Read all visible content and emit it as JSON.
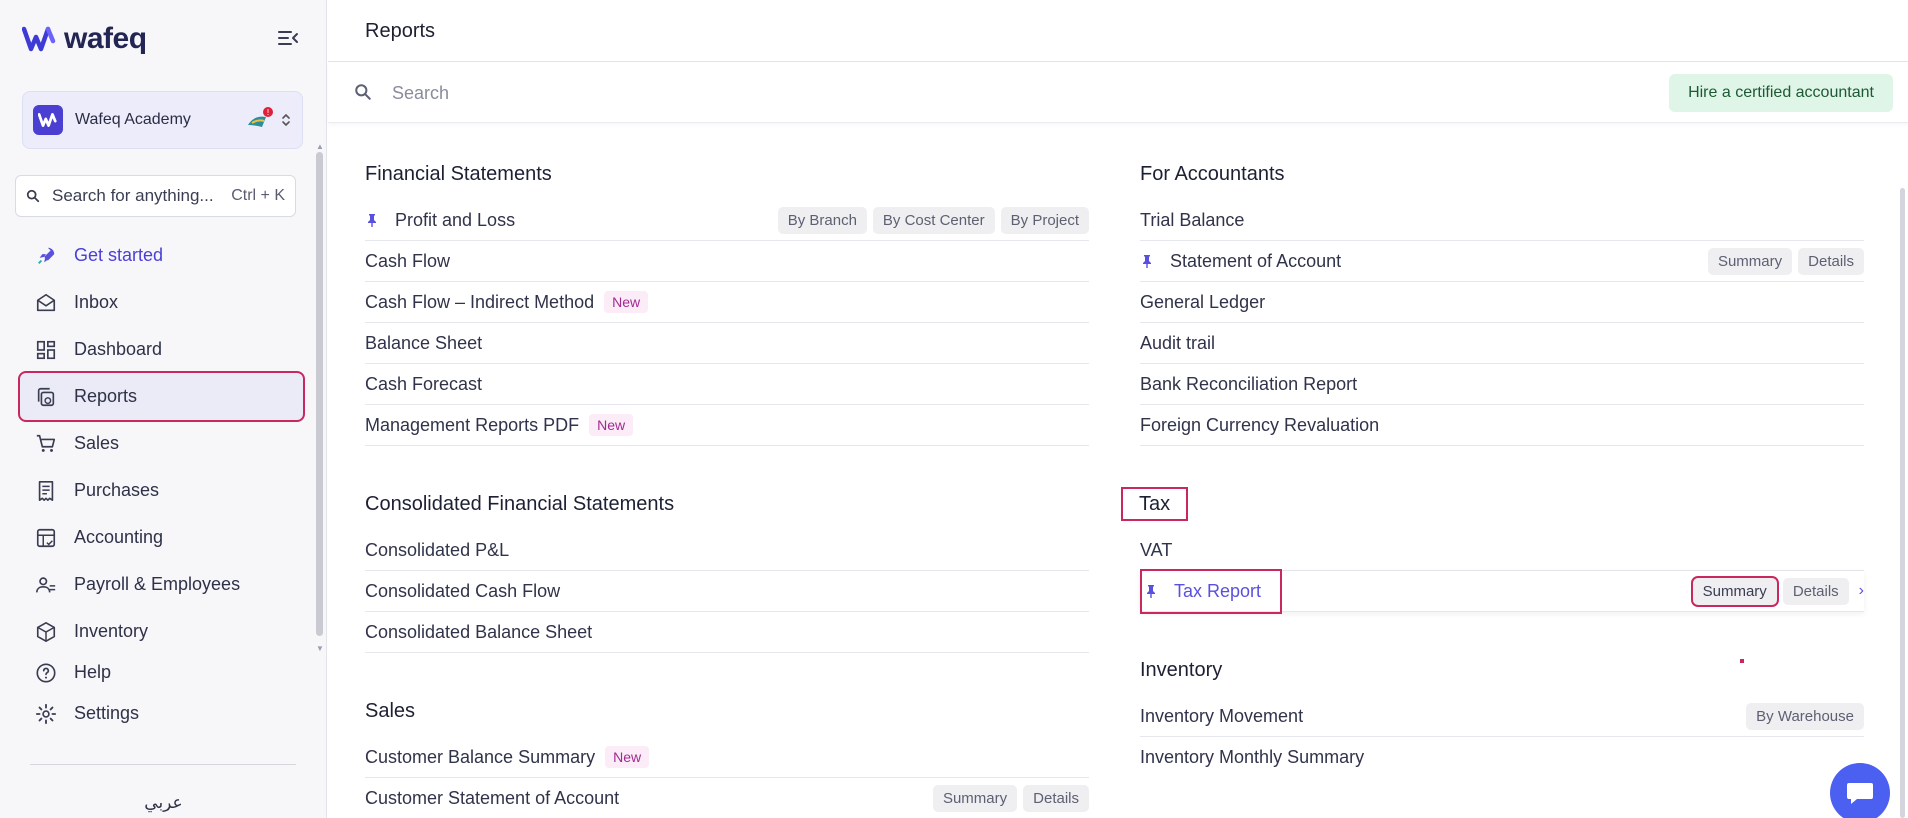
{
  "brand": {
    "name": "wafeq"
  },
  "org": {
    "name": "Wafeq Academy"
  },
  "search": {
    "placeholder": "Search for anything...",
    "shortcut": "Ctrl + K"
  },
  "nav": [
    {
      "label": "Get started",
      "icon": "rocket-icon"
    },
    {
      "label": "Inbox",
      "icon": "inbox-icon"
    },
    {
      "label": "Dashboard",
      "icon": "dashboard-icon"
    },
    {
      "label": "Reports",
      "icon": "reports-icon"
    },
    {
      "label": "Sales",
      "icon": "cart-icon"
    },
    {
      "label": "Purchases",
      "icon": "receipt-icon"
    },
    {
      "label": "Accounting",
      "icon": "ledger-icon"
    },
    {
      "label": "Payroll & Employees",
      "icon": "people-icon"
    },
    {
      "label": "Inventory",
      "icon": "box-icon"
    },
    {
      "label": "Help",
      "icon": "help-icon"
    },
    {
      "label": "Settings",
      "icon": "gear-icon"
    }
  ],
  "language_toggle": "عربي",
  "page": {
    "title": "Reports"
  },
  "report_search": {
    "placeholder": "Search"
  },
  "hire_button": "Hire a certified accountant",
  "financial_statements": {
    "title": "Financial Statements",
    "rows": [
      {
        "label": "Profit and Loss",
        "pinned": true,
        "tags": [
          "By Branch",
          "By Cost Center",
          "By Project"
        ]
      },
      {
        "label": "Cash Flow"
      },
      {
        "label": "Cash Flow – Indirect Method",
        "badge": "New"
      },
      {
        "label": "Balance Sheet"
      },
      {
        "label": "Cash Forecast"
      },
      {
        "label": "Management Reports PDF",
        "badge": "New"
      }
    ]
  },
  "consolidated": {
    "title": "Consolidated Financial Statements",
    "rows": [
      {
        "label": "Consolidated P&L"
      },
      {
        "label": "Consolidated Cash Flow"
      },
      {
        "label": "Consolidated Balance Sheet"
      }
    ]
  },
  "sales": {
    "title": "Sales",
    "rows": [
      {
        "label": "Customer Balance Summary",
        "badge": "New"
      },
      {
        "label": "Customer Statement of Account",
        "tags": [
          "Summary",
          "Details"
        ]
      }
    ]
  },
  "for_accountants": {
    "title": "For Accountants",
    "rows": [
      {
        "label": "Trial Balance"
      },
      {
        "label": "Statement of Account",
        "pinned": true,
        "tags": [
          "Summary",
          "Details"
        ]
      },
      {
        "label": "General Ledger"
      },
      {
        "label": "Audit trail"
      },
      {
        "label": "Bank Reconciliation Report"
      },
      {
        "label": "Foreign Currency Revaluation"
      }
    ]
  },
  "tax": {
    "title": "Tax",
    "rows": [
      {
        "label": "VAT"
      },
      {
        "label": "Tax Report",
        "pinned": true,
        "tags": [
          "Summary",
          "Details"
        ]
      }
    ]
  },
  "inventory": {
    "title": "Inventory",
    "rows": [
      {
        "label": "Inventory Movement",
        "tags": [
          "By Warehouse"
        ]
      },
      {
        "label": "Inventory Monthly Summary"
      }
    ]
  },
  "colors": {
    "accent": "#4a3fd6",
    "highlight": "#c8285e",
    "hire_bg": "#dff5e7"
  }
}
